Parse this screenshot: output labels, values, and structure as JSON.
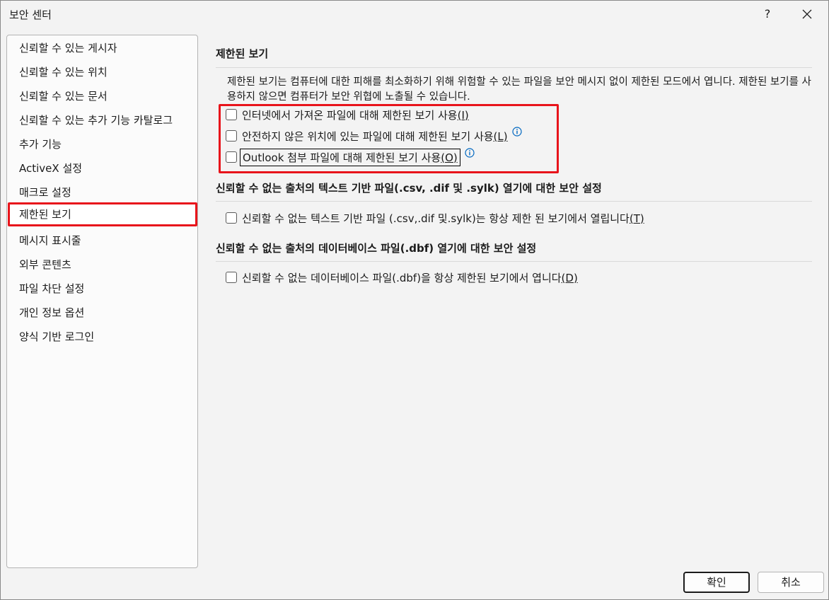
{
  "window": {
    "title": "보안 센터",
    "help_label": "?"
  },
  "sidebar": {
    "items": [
      {
        "label": "신뢰할 수 있는 게시자"
      },
      {
        "label": "신뢰할 수 있는 위치"
      },
      {
        "label": "신뢰할 수 있는 문서"
      },
      {
        "label": "신뢰할 수 있는 추가 기능 카탈로그"
      },
      {
        "label": "추가 기능"
      },
      {
        "label": "ActiveX 설정"
      },
      {
        "label": "매크로 설정"
      },
      {
        "label": "제한된 보기",
        "selected": true
      },
      {
        "label": "메시지 표시줄"
      },
      {
        "label": "외부 콘텐츠"
      },
      {
        "label": "파일 차단 설정"
      },
      {
        "label": "개인 정보 옵션"
      },
      {
        "label": "양식 기반 로그인"
      }
    ]
  },
  "main": {
    "protected_view": {
      "title": "제한된 보기",
      "description": "제한된 보기는 컴퓨터에 대한 피해를 최소화하기 위해 위험할 수 있는 파일을 보안 메시지 없이 제한된 모드에서 엽니다. 제한된 보기를 사용하지 않으면 컴퓨터가 보안 위협에 노출될 수 있습니다.",
      "options": [
        {
          "label": "인터넷에서 가져온 파일에 대해 제한된 보기 사용",
          "accel": "(I)",
          "checked": false
        },
        {
          "label": "안전하지 않은 위치에 있는 파일에 대해 제한된 보기 사용",
          "accel": "(L)",
          "checked": false
        },
        {
          "label": "Outlook 첨부 파일에 대해 제한된 보기 사용",
          "accel": "(O)",
          "checked": false
        }
      ]
    },
    "text_files": {
      "title": "신뢰할 수 없는 출처의 텍스트 기반 파일(.csv, .dif 및 .sylk) 열기에 대한 보안 설정",
      "option": {
        "label": "신뢰할 수 없는 텍스트 기반 파일 (.csv,.dif 및.sylk)는 항상 제한 된 보기에서 열립니다",
        "accel": "(T)",
        "checked": false
      }
    },
    "database_files": {
      "title": "신뢰할 수 없는 출처의 데이터베이스 파일(.dbf) 열기에 대한 보안 설정",
      "option": {
        "label": "신뢰할 수 없는 데이터베이스 파일(.dbf)을 항상 제한된 보기에서 엽니다",
        "accel": "(D)",
        "checked": false
      }
    }
  },
  "footer": {
    "ok_label": "확인",
    "cancel_label": "취소"
  },
  "colors": {
    "highlight_red": "#e8141b",
    "info_blue": "#0067c0"
  },
  "icons": {
    "info": "info-icon",
    "close": "close-icon"
  }
}
